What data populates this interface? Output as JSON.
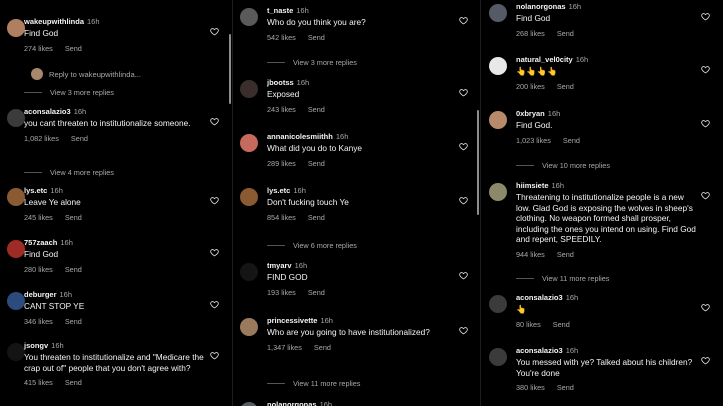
{
  "actions": {
    "send": "Send",
    "reply_to": "Reply to wakeupwithlinda..."
  },
  "columns": [
    {
      "comments": [
        {
          "username": "wakeupwithlinda",
          "time": "16h",
          "text": "Find God",
          "likes": "274 likes",
          "avatar": "#b07f63",
          "view_replies": "View 3 more replies",
          "reply_to": true
        },
        {
          "username": "aconsalazio3",
          "time": "16h",
          "text": "you cant threaten to institutionalize someone.",
          "likes": "1,082 likes",
          "avatar": "#3b3b3b",
          "view_replies": "View 4 more replies"
        },
        {
          "username": "lys.etc",
          "time": "16h",
          "text": "Leave Ye alone",
          "likes": "245 likes",
          "avatar": "#8a5a32"
        },
        {
          "username": "757zaach",
          "time": "16h",
          "text": "Find God",
          "likes": "280 likes",
          "avatar": "#a02a25"
        },
        {
          "username": "deburger",
          "time": "16h",
          "text": "CANT STOP YE",
          "likes": "346 likes",
          "avatar": "#2c4a7c"
        },
        {
          "username": "jsongv",
          "time": "16h",
          "text": "You threaten to institutionalize and \"Medicare the crap out of\" people that you don't agree with?",
          "likes": "415 likes",
          "avatar": "#141414"
        }
      ]
    },
    {
      "comments": [
        {
          "username": "t_naste",
          "time": "16h",
          "text": "Who do you think you are?",
          "likes": "542 likes",
          "avatar": "#5a5a5a",
          "view_replies": "View 3 more replies"
        },
        {
          "username": "jbootss",
          "time": "16h",
          "text": "Exposed",
          "likes": "243 likes",
          "avatar": "#3a2e2a"
        },
        {
          "username": "annanicolesmiithh",
          "time": "16h",
          "text": "What did you do to Kanye",
          "likes": "289 likes",
          "avatar": "#c56a5c"
        },
        {
          "username": "lys.etc",
          "time": "16h",
          "text": "Don't fucking touch Ye",
          "likes": "854 likes",
          "avatar": "#8a5a32",
          "view_replies": "View 6 more replies"
        },
        {
          "username": "tmyarv",
          "time": "16h",
          "text": "FIND GOD",
          "likes": "193 likes",
          "avatar": "#151515"
        },
        {
          "username": "princessivette",
          "time": "16h",
          "text": "Who are you going to have institutionalized?",
          "likes": "1,347 likes",
          "avatar": "#9a7a5c",
          "view_replies": "View 11 more replies"
        },
        {
          "username": "nolanorgonas",
          "time": "16h",
          "text": "",
          "likes": "",
          "avatar": "#555a66"
        }
      ]
    },
    {
      "comments": [
        {
          "username": "nolanorgonas",
          "time": "16h",
          "text": "Find God",
          "likes": "268 likes",
          "avatar": "#555a66"
        },
        {
          "username": "natural_vel0city",
          "time": "16h",
          "text": "👆👆👆👆",
          "likes": "200 likes",
          "avatar": "#e8e8e8"
        },
        {
          "username": "0xbryan",
          "time": "16h",
          "text": "Find God.",
          "likes": "1,023 likes",
          "avatar": "#b88a6c",
          "view_replies": "View 10 more replies"
        },
        {
          "username": "hiimsiete",
          "time": "16h",
          "text": "Threatening to institutionalize people is a new low. Glad God is exposing the wolves in sheep's clothing. No weapon formed shall prosper, including the ones you intend on using. Find God and repent, SPEEDILY.",
          "likes": "944 likes",
          "avatar": "#8a8a6a",
          "view_replies": "View 11 more replies"
        },
        {
          "username": "aconsalazio3",
          "time": "16h",
          "text": "👆",
          "likes": "80 likes",
          "avatar": "#3b3b3b"
        },
        {
          "username": "aconsalazio3",
          "time": "16h",
          "text": "You messed with ye? Talked about his children? You're done",
          "likes": "380 likes",
          "avatar": "#3b3b3b"
        }
      ]
    }
  ]
}
